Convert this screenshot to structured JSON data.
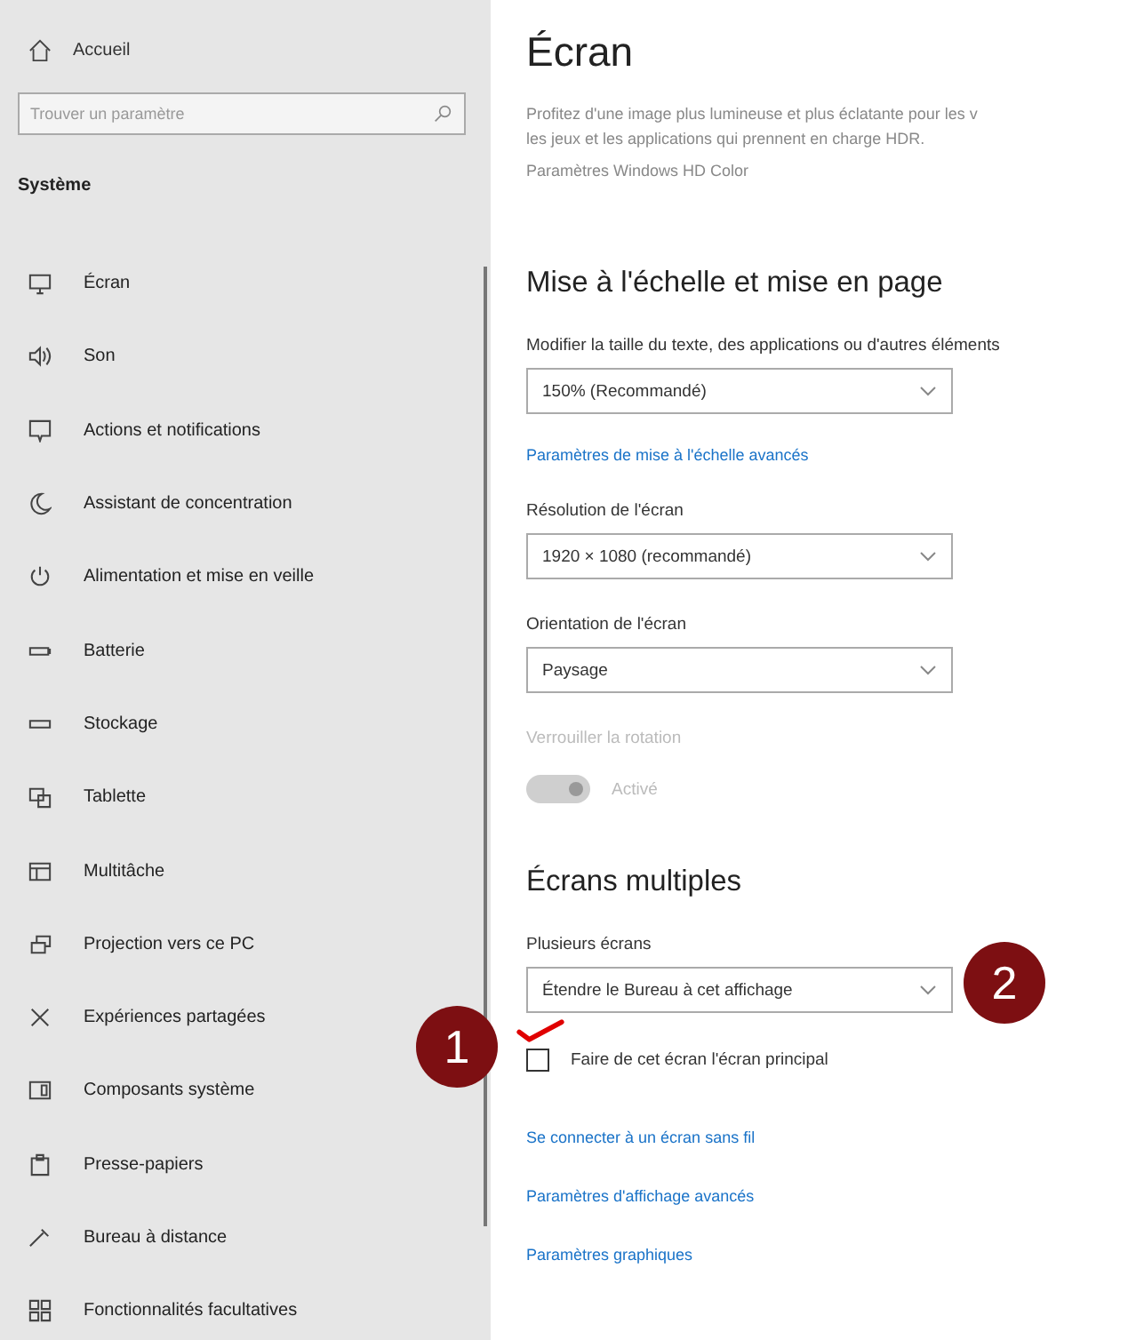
{
  "sidebar": {
    "home": "Accueil",
    "search": {
      "placeholder": "Trouver un paramètre"
    },
    "section": "Système",
    "items": [
      {
        "label": "Écran"
      },
      {
        "label": "Son"
      },
      {
        "label": "Actions et notifications"
      },
      {
        "label": "Assistant de concentration"
      },
      {
        "label": "Alimentation et mise en veille"
      },
      {
        "label": "Batterie"
      },
      {
        "label": "Stockage"
      },
      {
        "label": "Tablette"
      },
      {
        "label": "Multitâche"
      },
      {
        "label": "Projection vers ce PC"
      },
      {
        "label": "Expériences partagées"
      },
      {
        "label": "Composants système"
      },
      {
        "label": "Presse-papiers"
      },
      {
        "label": "Bureau à distance"
      },
      {
        "label": "Fonctionnalités facultatives"
      }
    ]
  },
  "main": {
    "title": "Écran",
    "description": [
      "Profitez d'une image plus lumineuse et plus éclatante pour les v",
      "les jeux et les applications qui prennent en charge HDR."
    ],
    "hd_link": "Paramètres Windows HD Color",
    "scale_section": {
      "heading": "Mise à l'échelle et mise en page",
      "scale_label": "Modifier la taille du texte, des applications ou d'autres éléments",
      "scale_value": "150% (Recommandé)",
      "advanced_link": "Paramètres de mise à l'échelle avancés",
      "resolution_label": "Résolution de l'écran",
      "resolution_value": "1920 × 1080 (recommandé)",
      "orientation_label": "Orientation de l'écran",
      "orientation_value": "Paysage",
      "rotation_label": "Verrouiller la rotation",
      "rotation_toggle": {
        "on": true,
        "disabled": true,
        "label": "Activé"
      }
    },
    "multi_section": {
      "heading": "Écrans multiples",
      "label": "Plusieurs écrans",
      "value": "Étendre le Bureau à cet affichage",
      "checkbox": {
        "label": "Faire de cet écran l'écran principal",
        "checked": false
      },
      "links": [
        "Se connecter à un écran sans fil",
        "Paramètres d'affichage avancés",
        "Paramètres graphiques"
      ]
    }
  },
  "annotations": [
    {
      "number": "1"
    },
    {
      "number": "2"
    }
  ]
}
